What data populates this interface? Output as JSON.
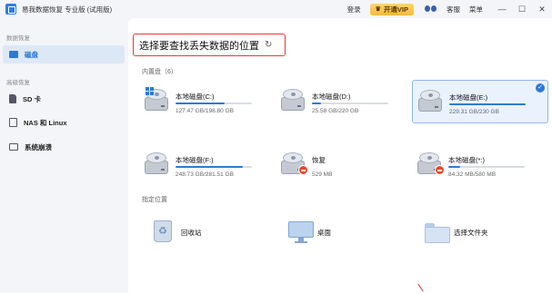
{
  "app": {
    "title": "易我数据恢复 专业版 (试用版)"
  },
  "titlebar": {
    "login": "登录",
    "vip": "开通VIP",
    "help": "客服",
    "menu": "菜单",
    "minimize": "—",
    "maximize": "☐",
    "close": "✕"
  },
  "sidebar": {
    "section_data": "数据恢复",
    "disk": "磁盘",
    "section_advanced": "高级恢复",
    "sd": "SD 卡",
    "nas": "NAS 和 Linux",
    "sys": "系统崩溃"
  },
  "main": {
    "heading": "选择要查找丢失数据的位置",
    "refresh_icon": "↻",
    "section_builtin": "内置盘（6）",
    "section_specified": "指定位置",
    "drives": [
      {
        "name": "本地磁盘(C:)",
        "size": "127.47 GB/198.80 GB",
        "usage": 0.64,
        "selected": false,
        "system": true,
        "error": false
      },
      {
        "name": "本地磁盘(D:)",
        "size": "25.58 GB/220 GB",
        "usage": 0.12,
        "selected": false,
        "system": false,
        "error": false
      },
      {
        "name": "本地磁盘(E:)",
        "size": "229.31 GB/230 GB",
        "usage": 0.997,
        "selected": true,
        "system": false,
        "error": false
      },
      {
        "name": "本地磁盘(F:)",
        "size": "248.73 GB/281.51 GB",
        "usage": 0.88,
        "selected": false,
        "system": false,
        "error": false
      },
      {
        "name": "恢复",
        "size": "529 MB",
        "usage": 0.0,
        "selected": false,
        "system": false,
        "error": true
      },
      {
        "name": "本地磁盘(*:)",
        "size": "84.32 MB/580 MB",
        "usage": 0.15,
        "selected": false,
        "system": false,
        "error": true
      }
    ],
    "locations": [
      {
        "label": "回收站",
        "icon": "recycle-bin-icon"
      },
      {
        "label": "桌面",
        "icon": "desktop-icon"
      },
      {
        "label": "选择文件夹",
        "icon": "folder-icon"
      }
    ]
  },
  "colors": {
    "accent": "#2d7ad6",
    "highlight": "#e63a2e",
    "vip": "#f6b93b"
  }
}
